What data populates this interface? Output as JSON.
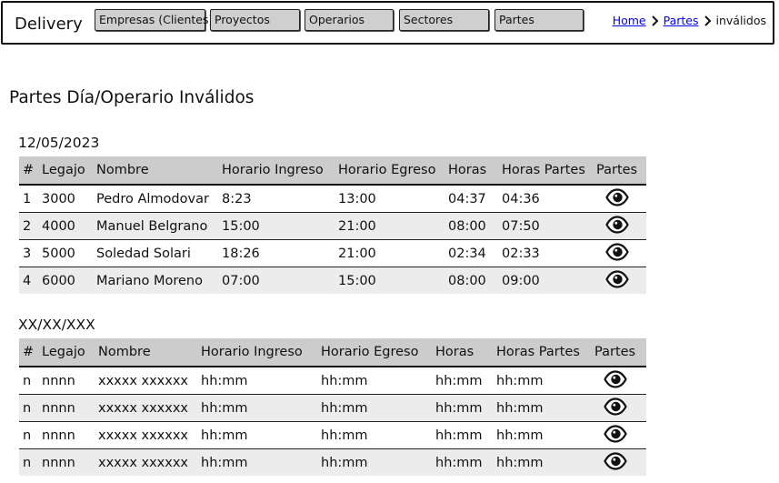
{
  "header": {
    "brand": "Delivery",
    "nav": [
      {
        "label": "Empresas (Clientes)"
      },
      {
        "label": "Proyectos"
      },
      {
        "label": "Operarios"
      },
      {
        "label": "Sectores"
      },
      {
        "label": "Partes"
      }
    ],
    "breadcrumb": {
      "home": "Home",
      "partes": "Partes",
      "current": "inválidos"
    }
  },
  "page": {
    "title": "Partes Día/Operario Inválidos"
  },
  "sections": [
    {
      "date": "12/05/2023",
      "columns": [
        "#",
        "Legajo",
        "Nombre",
        "Horario Ingreso",
        "Horario Egreso",
        "Horas",
        "Horas Partes",
        "Partes"
      ],
      "rows": [
        {
          "n": "1",
          "legajo": "3000",
          "nombre": "Pedro Almodovar",
          "ingreso": "8:23",
          "egreso": "13:00",
          "horas": "04:37",
          "horas_partes": "04:36"
        },
        {
          "n": "2",
          "legajo": "4000",
          "nombre": "Manuel Belgrano",
          "ingreso": "15:00",
          "egreso": "21:00",
          "horas": "08:00",
          "horas_partes": "07:50"
        },
        {
          "n": "3",
          "legajo": "5000",
          "nombre": "Soledad Solari",
          "ingreso": "18:26",
          "egreso": "21:00",
          "horas": "02:34",
          "horas_partes": "02:33"
        },
        {
          "n": "4",
          "legajo": "6000",
          "nombre": "Mariano Moreno",
          "ingreso": "07:00",
          "egreso": "15:00",
          "horas": "08:00",
          "horas_partes": "09:00"
        }
      ]
    },
    {
      "date": "XX/XX/XXX",
      "columns": [
        "#",
        "Legajo",
        "Nombre",
        "Horario Ingreso",
        "Horario Egreso",
        "Horas",
        "Horas Partes",
        "Partes"
      ],
      "rows": [
        {
          "n": "n",
          "legajo": "nnnn",
          "nombre": "xxxxx xxxxxx",
          "ingreso": "hh:mm",
          "egreso": "hh:mm",
          "horas": "hh:mm",
          "horas_partes": "hh:mm"
        },
        {
          "n": "n",
          "legajo": "nnnn",
          "nombre": "xxxxx xxxxxx",
          "ingreso": "hh:mm",
          "egreso": "hh:mm",
          "horas": "hh:mm",
          "horas_partes": "hh:mm"
        },
        {
          "n": "n",
          "legajo": "nnnn",
          "nombre": "xxxxx xxxxxx",
          "ingreso": "hh:mm",
          "egreso": "hh:mm",
          "horas": "hh:mm",
          "horas_partes": "hh:mm"
        },
        {
          "n": "n",
          "legajo": "nnnn",
          "nombre": "xxxxx xxxxxx",
          "ingreso": "hh:mm",
          "egreso": "hh:mm",
          "horas": "hh:mm",
          "horas_partes": "hh:mm"
        }
      ]
    }
  ],
  "icons": {
    "breadcrumb_separator": "chevron-right-icon",
    "partes_action": "eye-icon"
  },
  "colors": {
    "header_bg": "#cccccc",
    "alt_row": "#ececec",
    "link": "#0000ee"
  }
}
